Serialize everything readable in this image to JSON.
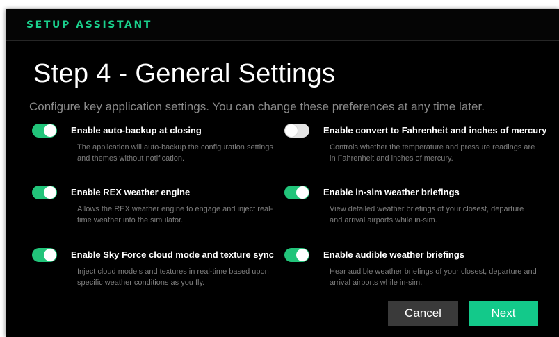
{
  "window": {
    "header_title": "SETUP ASSISTANT",
    "step_title": "Step 4 - General Settings",
    "subtitle": "Configure key application settings. You can change these preferences at any time later."
  },
  "settings": [
    {
      "label": "Enable auto-backup at closing",
      "enabled": true,
      "description": "The application will auto-backup the configuration settings and themes without notification."
    },
    {
      "label": "Enable convert to Fahrenheit and inches of mercury",
      "enabled": false,
      "description": "Controls whether the temperature and pressure readings are in Fahrenheit and inches of mercury."
    },
    {
      "label": "Enable REX weather engine",
      "enabled": true,
      "description": "Allows the REX weather engine to engage and inject real-time weather into the simulator."
    },
    {
      "label": "Enable in-sim weather briefings",
      "enabled": true,
      "description": "View detailed weather briefings of your closest, departure and arrival airports while in-sim."
    },
    {
      "label": "Enable Sky Force cloud mode and texture sync",
      "enabled": true,
      "description": "Inject cloud models and textures in real-time based upon specific weather conditions as you fly."
    },
    {
      "label": "Enable audible weather briefings",
      "enabled": true,
      "description": "Hear audible weather briefings of your closest, departure and arrival airports while in-sim."
    }
  ],
  "buttons": {
    "cancel": "Cancel",
    "next": "Next"
  },
  "colors": {
    "accent": "#1ad18d",
    "toggle_on": "#22c47a",
    "next_button": "#13c98a",
    "cancel_button": "#3a3a3a"
  }
}
